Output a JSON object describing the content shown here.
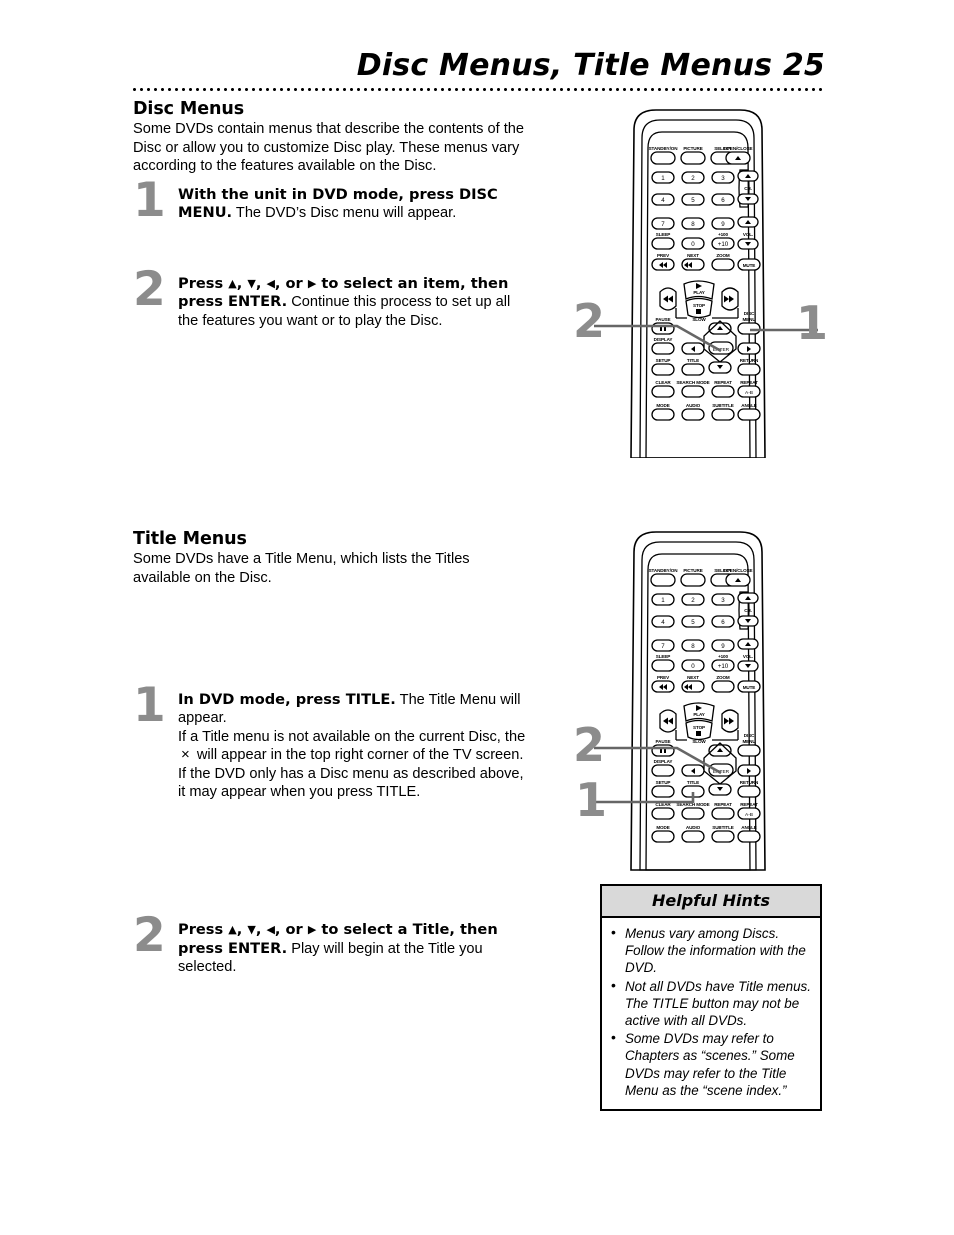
{
  "header": {
    "title": "Disc Menus, Title Menus  25",
    "page_number": "25"
  },
  "sections": [
    {
      "id": "disc-menus",
      "heading": "Disc Menus",
      "intro": "Some DVDs contain menus that describe the contents of the Disc or allow you to customize Disc play. These menus vary according to the features available on the Disc.",
      "steps": [
        {
          "number": "1",
          "bold_lead": "With the unit in DVD mode, press DISC MENU.",
          "rest": " The DVD’s Disc menu will appear."
        },
        {
          "number": "2",
          "bold_lead_a": "Press ",
          "bold_lead_b": ", ",
          "bold_lead_c": ", ",
          "bold_lead_d": ", or ",
          "bold_lead_e": " to select an item, then press ENTER.",
          "rest": " Continue this process to set up all the features you want or to play the Disc."
        }
      ]
    },
    {
      "id": "title-menus",
      "heading": "Title Menus",
      "intro": "Some DVDs have a Title Menu, which lists the Titles available on the Disc.",
      "steps": [
        {
          "number": "1",
          "bold_lead": "In DVD mode, press TITLE.",
          "rest": " The Title Menu will appear.",
          "rest2_a": "If a Title menu is not available on the current Disc, the ",
          "rest2_b": " will appear in the top right corner of the TV screen. If the DVD only has a Disc menu as described above, it may appear when you press TITLE."
        },
        {
          "number": "2",
          "bold_lead_a": "Press ",
          "bold_lead_b": ", ",
          "bold_lead_c": ", ",
          "bold_lead_d": ", or ",
          "bold_lead_e": " to select a Title, then press ENTER.",
          "rest": " Play will begin at the Title you selected."
        }
      ]
    }
  ],
  "glyphs": {
    "up": "▲",
    "down": "▼",
    "left": "◀",
    "right": "▶",
    "x_mark": "×"
  },
  "hints": {
    "title": "Helpful Hints",
    "items": [
      "Menus vary among Discs. Follow the information with the DVD.",
      "Not all DVDs have Title menus. The TITLE button may not be active with all DVDs.",
      "Some DVDs may refer to Chapters as “scenes.” Some DVDs may refer to the Title Menu as the “scene index.”"
    ]
  },
  "remote": {
    "row_top": [
      "STANDBY/ON",
      "PICTURE",
      "SELECT",
      "OPEN/CLOSE"
    ],
    "numpad": [
      "1",
      "2",
      "3",
      "4",
      "5",
      "6",
      "7",
      "8",
      "9",
      "0"
    ],
    "plus100": "+100",
    "plus10": "+10",
    "sleep": "SLEEP",
    "ch": "CH.",
    "vol": "VOL.",
    "prev": "PREV",
    "next": "NEXT",
    "zoom": "ZOOM",
    "mute": "MUTE",
    "play": "PLAY",
    "stop": "STOP",
    "pause": "PAUSE",
    "slow": "SLOW",
    "disc_menu_line1": "DISC",
    "disc_menu_line2": "MENU",
    "display": "DISPLAY",
    "enter": "ENTER",
    "setup": "SETUP",
    "title": "TITLE",
    "return": "RETURN",
    "clear": "CLEAR",
    "search_mode": "SEARCH MODE",
    "repeat": "REPEAT",
    "repeat_ab": "REPEAT",
    "ab": "A-B",
    "mode": "MODE",
    "audio": "AUDIO",
    "subtitle": "SUBTITLE",
    "angle": "ANGLE"
  },
  "callouts": {
    "fig1": {
      "left": "2",
      "right": "1"
    },
    "fig2": {
      "upper": "2",
      "lower": "1"
    }
  },
  "colors": {
    "step_number_gray": "#8c8c8c",
    "hints_header_bg": "#d9d9d9",
    "ink": "#000000",
    "page_bg": "#ffffff"
  }
}
